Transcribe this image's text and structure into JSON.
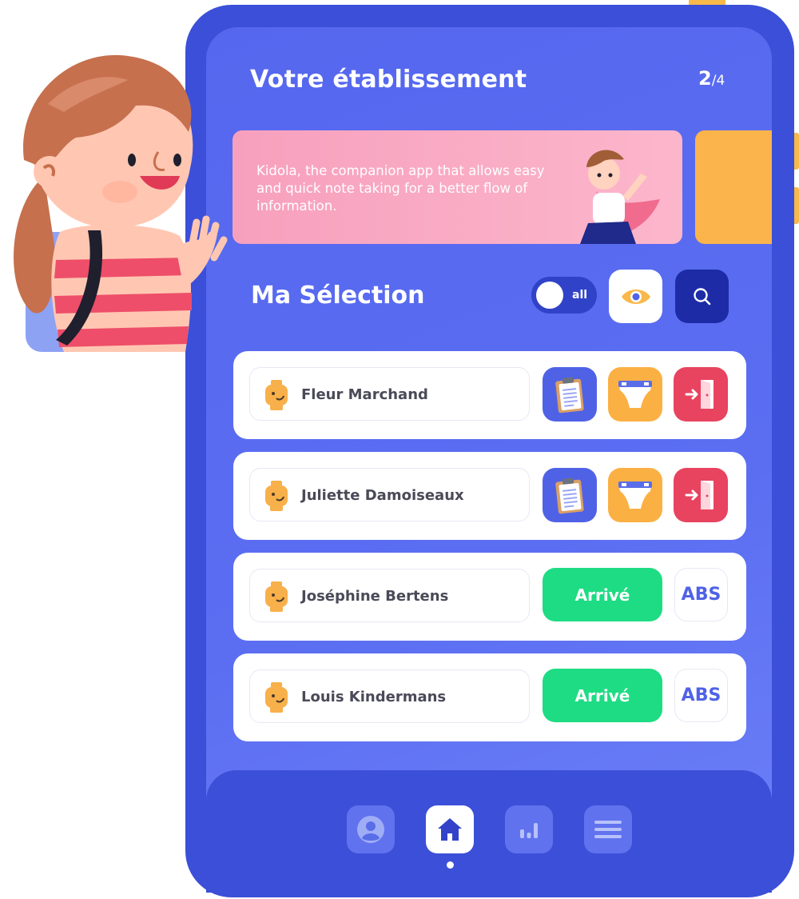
{
  "header": {
    "title": "Votre établissement",
    "pager_current": "2",
    "pager_sep": "/",
    "pager_total": "4"
  },
  "banner": {
    "text": "Kidola, the companion app that allows easy and quick note taking for a better flow of information."
  },
  "selection": {
    "title": "Ma Sélection",
    "toggle_label": "all",
    "eye_icon": "eye-icon",
    "search_icon": "search-icon"
  },
  "children": [
    {
      "name": "Fleur Marchand",
      "mode": "actions",
      "actions": [
        "clipboard-icon",
        "diaper-icon",
        "door-exit-icon"
      ]
    },
    {
      "name": "Juliette Damoiseaux",
      "mode": "actions",
      "actions": [
        "clipboard-icon",
        "diaper-icon",
        "door-exit-icon"
      ]
    },
    {
      "name": "Joséphine Bertens",
      "mode": "arrival",
      "arrive_label": "Arrivé",
      "absent_label": "ABS"
    },
    {
      "name": "Louis Kindermans",
      "mode": "arrival",
      "arrive_label": "Arrivé",
      "absent_label": "ABS"
    }
  ],
  "nav": {
    "items": [
      "profile-icon",
      "home-icon",
      "stats-icon",
      "menu-icon"
    ],
    "active": "home-icon"
  },
  "colors": {
    "primary": "#4f62e6",
    "device": "#3c4fd8",
    "arrive": "#1edc83",
    "exit": "#e8435f",
    "diaper": "#fbb044",
    "banner": "#fcb6cc"
  }
}
